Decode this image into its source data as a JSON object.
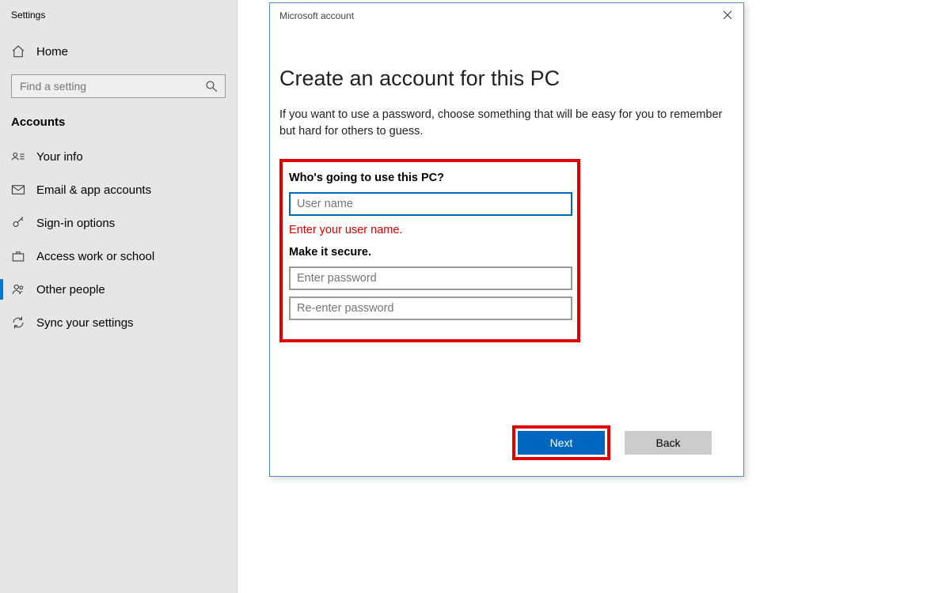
{
  "settings": {
    "title": "Settings",
    "home_label": "Home",
    "search_placeholder": "Find a setting",
    "section": "Accounts",
    "nav": {
      "your_info": "Your info",
      "email": "Email & app accounts",
      "signin": "Sign-in options",
      "work": "Access work or school",
      "other": "Other people",
      "sync": "Sync your settings"
    }
  },
  "dialog": {
    "window_title": "Microsoft account",
    "title": "Create an account for this PC",
    "description": "If you want to use a password, choose something that will be easy for you to remember but hard for others to guess.",
    "section_user_label": "Who's going to use this PC?",
    "username_placeholder": "User name",
    "username_error": "Enter your user name.",
    "section_secure_label": "Make it secure.",
    "password_placeholder": "Enter password",
    "password2_placeholder": "Re-enter password",
    "next_label": "Next",
    "back_label": "Back"
  }
}
